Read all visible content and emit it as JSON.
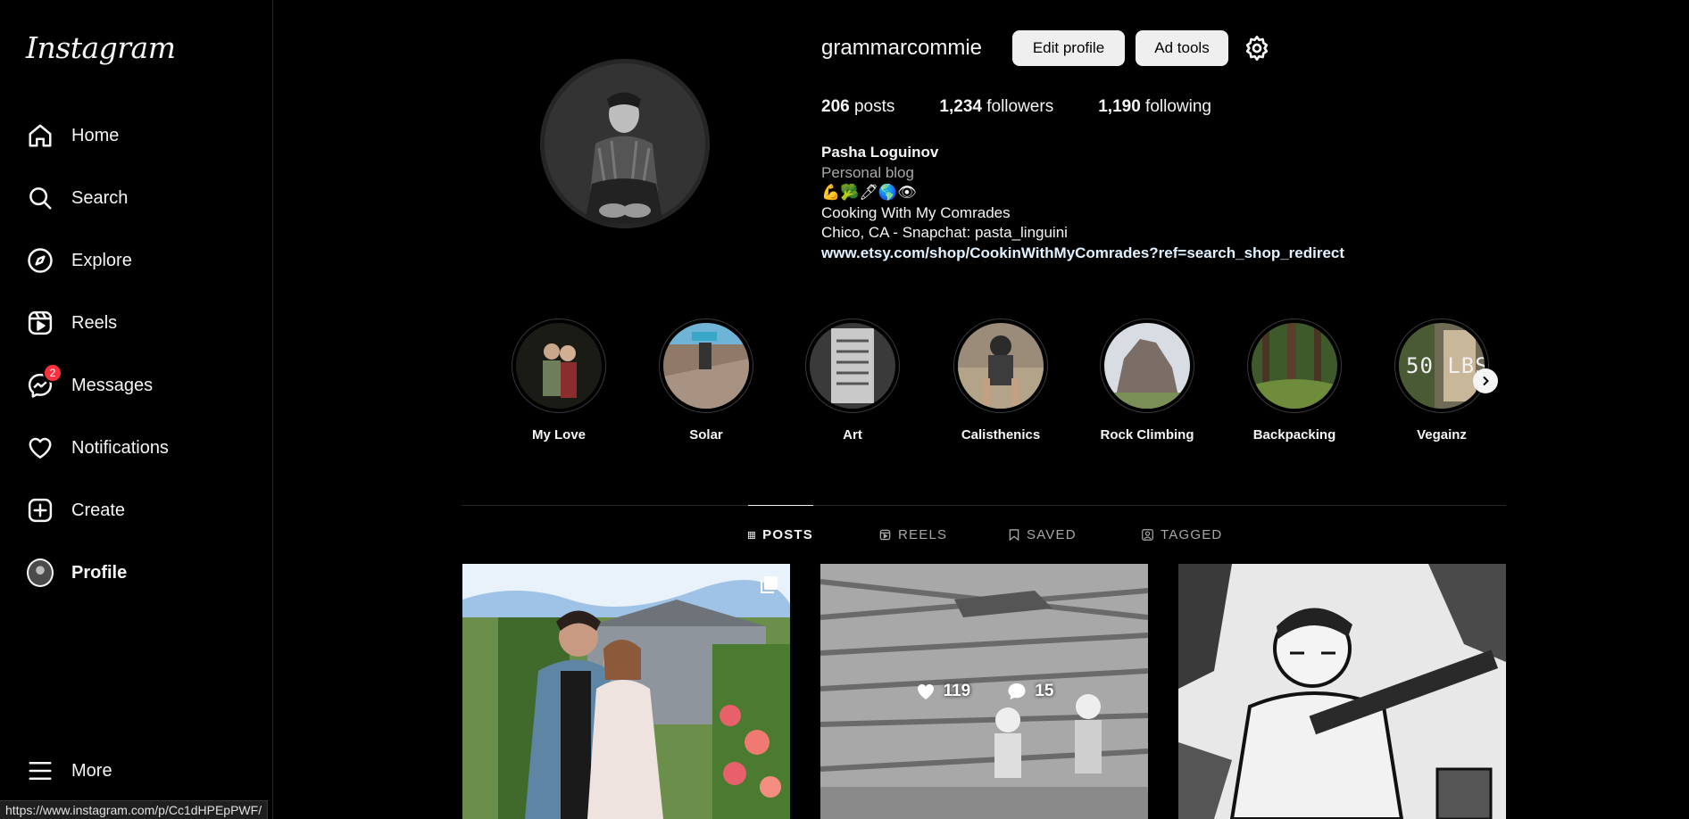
{
  "sidebar": {
    "logo": "Instagram",
    "items": [
      {
        "label": "Home"
      },
      {
        "label": "Search"
      },
      {
        "label": "Explore"
      },
      {
        "label": "Reels"
      },
      {
        "label": "Messages",
        "badge": "2"
      },
      {
        "label": "Notifications"
      },
      {
        "label": "Create"
      },
      {
        "label": "Profile"
      },
      {
        "label": "More"
      }
    ]
  },
  "status_url": "https://www.instagram.com/p/Cc1dHPEpPWF/",
  "profile": {
    "username": "grammarcommie",
    "edit_label": "Edit profile",
    "ad_tools_label": "Ad tools",
    "stats": {
      "posts_count": "206",
      "posts_label": "posts",
      "followers_count": "1,234",
      "followers_label": "followers",
      "following_count": "1,190",
      "following_label": "following"
    },
    "bio": {
      "name": "Pasha Loguinov",
      "category": "Personal blog",
      "emojis": "💪🥦🖊🌎👁",
      "line1": "Cooking With My Comrades",
      "line2": "Chico, CA - Snapchat: pasta_linguini",
      "link": "www.etsy.com/shop/CookinWithMyComrades?ref=search_shop_redirect"
    }
  },
  "highlights": [
    {
      "label": "My Love"
    },
    {
      "label": "Solar"
    },
    {
      "label": "Art"
    },
    {
      "label": "Calisthenics"
    },
    {
      "label": "Rock Climbing"
    },
    {
      "label": "Backpacking"
    },
    {
      "label": "Vegainz"
    }
  ],
  "highlight_overlay_text": "50 LBS",
  "tabs": [
    {
      "label": "POSTS"
    },
    {
      "label": "REELS"
    },
    {
      "label": "SAVED"
    },
    {
      "label": "TAGGED"
    }
  ],
  "posts": [
    {
      "likes": "",
      "comments": ""
    },
    {
      "likes": "119",
      "comments": "15"
    },
    {
      "likes": "",
      "comments": ""
    }
  ],
  "colors": {
    "background": "#000000",
    "text": "#f5f5f5",
    "badge": "#ff3040",
    "button": "#efefef"
  }
}
